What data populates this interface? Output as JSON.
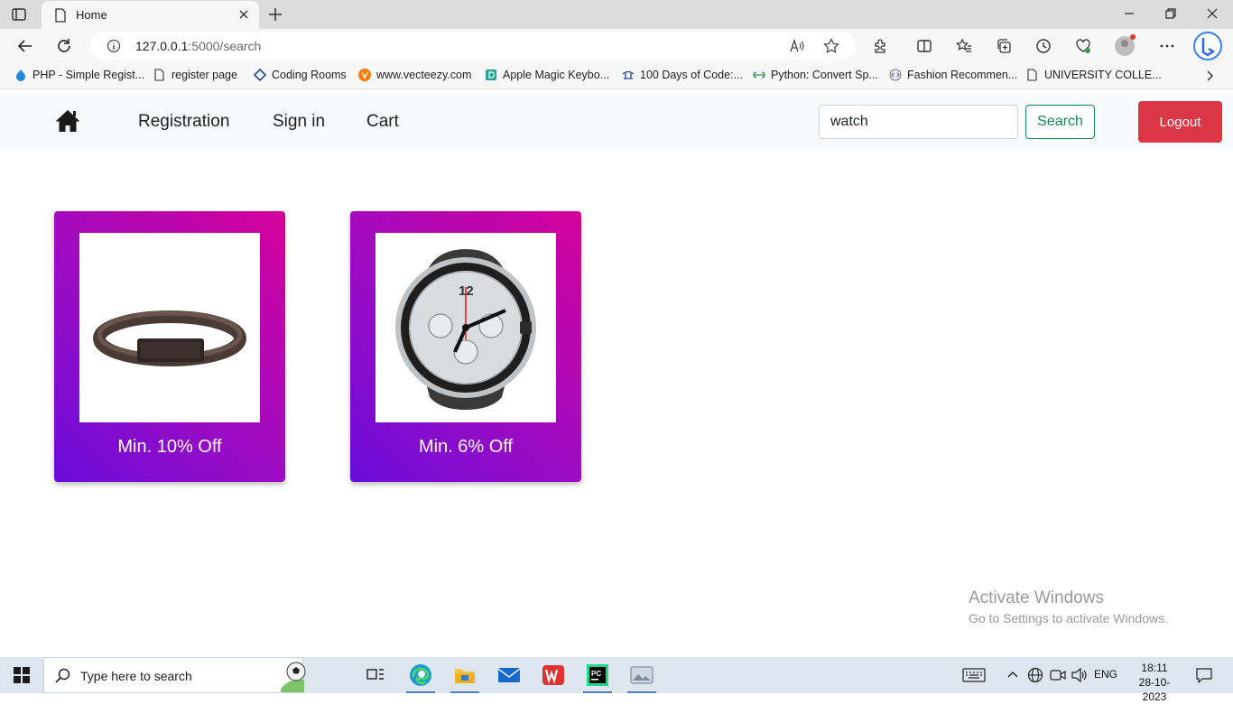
{
  "browser": {
    "tab_title": "Home",
    "url_host": "127.0.0.1",
    "url_path": ":5000/search",
    "bookmarks": [
      "PHP - Simple Regist...",
      "register page",
      "Coding Rooms",
      "www.vecteezy.com",
      "Apple Magic Keybo...",
      "100 Days of Code:...",
      "Python: Convert Sp...",
      "Fashion Recommen...",
      "UNIVERSITY COLLE..."
    ]
  },
  "navbar": {
    "links": [
      "Registration",
      "Sign in",
      "Cart"
    ],
    "search_value": "watch",
    "search_button": "Search",
    "logout_button": "Logout"
  },
  "products": [
    {
      "caption": "Min. 10% Off",
      "image": "leather-bracelet"
    },
    {
      "caption": "Min. 6% Off",
      "image": "chronograph-watch"
    }
  ],
  "watermark": {
    "line1": "Activate Windows",
    "line2": "Go to Settings to activate Windows."
  },
  "taskbar": {
    "search_placeholder": "Type here to search",
    "language": "ENG",
    "time": "18:11",
    "date": "28-10-2023"
  },
  "colors": {
    "card_gradient_start": "#6a0ddb",
    "card_gradient_end": "#d6009a",
    "search_button": "#198754",
    "logout_button": "#dc3545"
  }
}
